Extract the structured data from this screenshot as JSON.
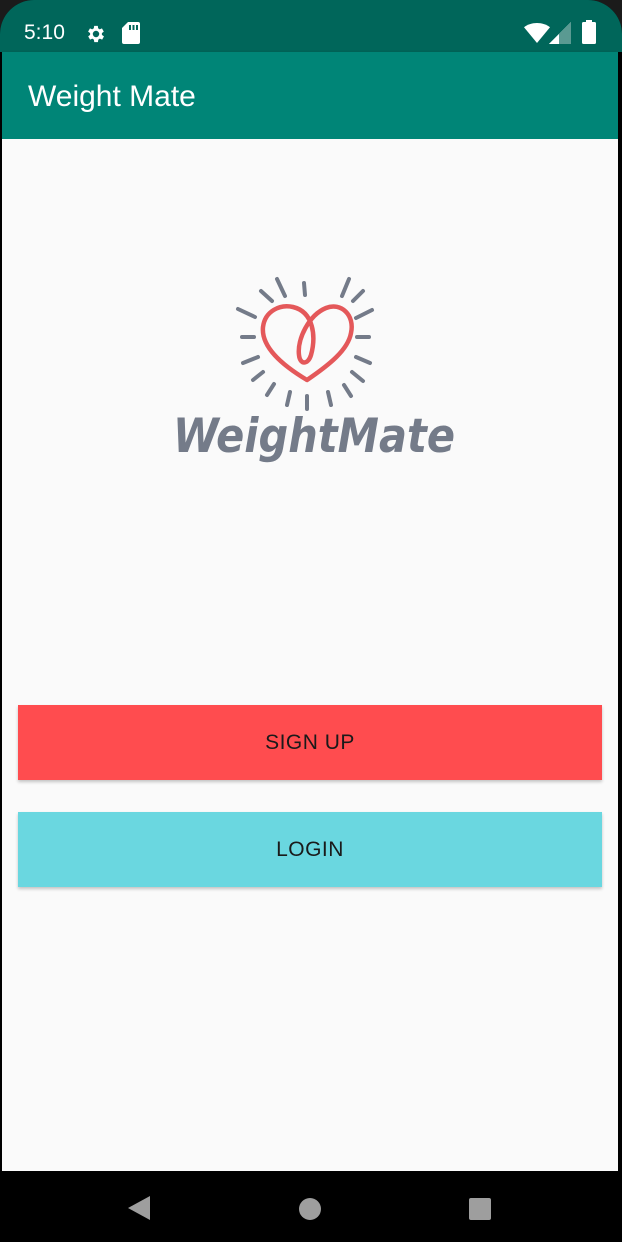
{
  "status_bar": {
    "time": "5:10",
    "icons": [
      "settings-icon",
      "sd-card-icon",
      "wifi-icon",
      "cell-signal-icon",
      "battery-icon"
    ]
  },
  "app_bar": {
    "title": "Weight Mate"
  },
  "logo": {
    "text": "WeightMate",
    "heart_color": "#e4585a",
    "rays_color": "#747b89"
  },
  "buttons": {
    "signup_label": "SIGN UP",
    "login_label": "LOGIN",
    "signup_color": "#ff4c4f",
    "login_color": "#6ad7e0"
  },
  "nav_bar": {
    "icons": [
      "back-icon",
      "home-icon",
      "recents-icon"
    ]
  },
  "colors": {
    "primary": "#008577",
    "primary_dark": "#00665a",
    "background": "#fafafa"
  }
}
